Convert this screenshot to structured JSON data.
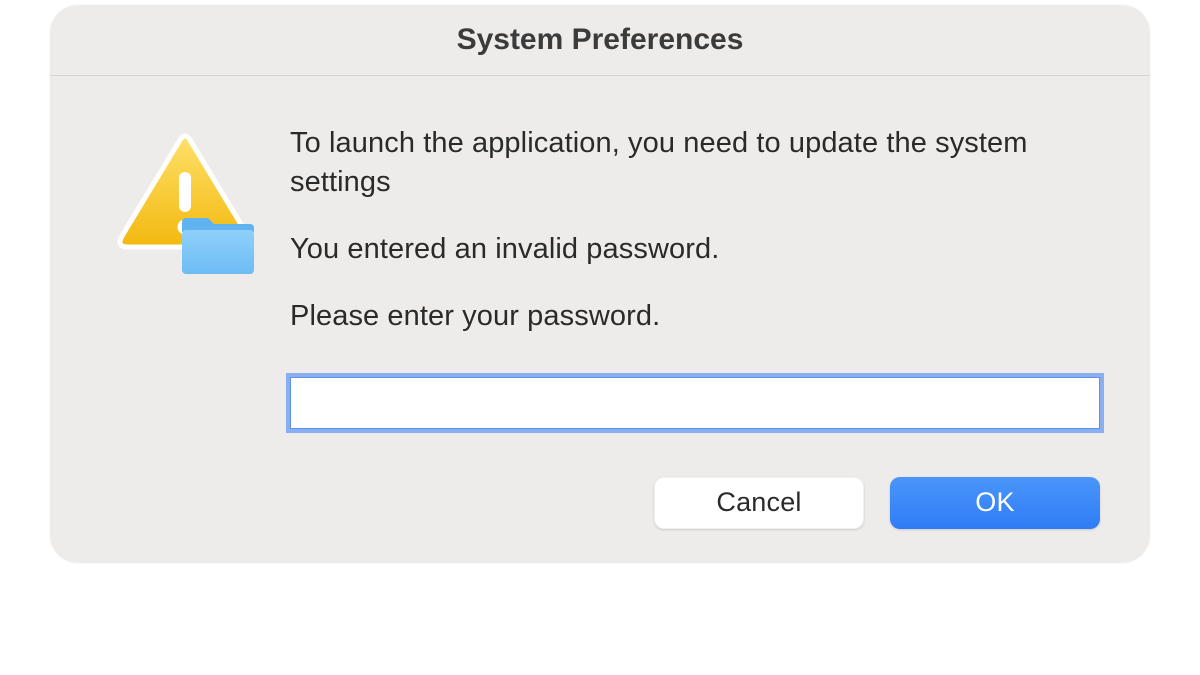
{
  "dialog": {
    "title": "System Preferences",
    "message_primary": "To launch the application, you need to update the system settings",
    "message_error": "You entered an invalid password.",
    "message_prompt": "Please enter your password.",
    "password_value": "",
    "buttons": {
      "cancel": "Cancel",
      "ok": "OK"
    }
  }
}
